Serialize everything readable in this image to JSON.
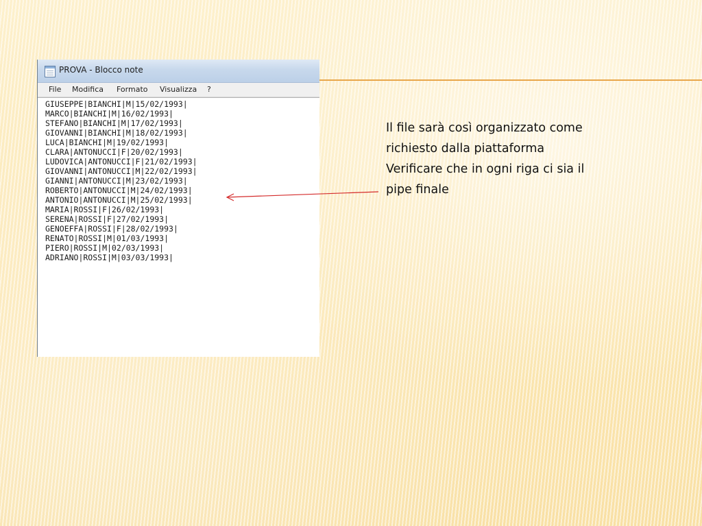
{
  "window": {
    "title": "PROVA - Blocco note",
    "icon": "notepad-icon"
  },
  "menu": [
    "File",
    "Modifica",
    "Formato",
    "Visualizza",
    "?"
  ],
  "editor_lines": [
    "GIUSEPPE|BIANCHI|M|15/02/1993|",
    "MARCO|BIANCHI|M|16/02/1993|",
    "STEFANO|BIANCHI|M|17/02/1993|",
    "GIOVANNI|BIANCHI|M|18/02/1993|",
    "LUCA|BIANCHI|M|19/02/1993|",
    "CLARA|ANTONUCCI|F|20/02/1993|",
    "LUDOVICA|ANTONUCCI|F|21/02/1993|",
    "GIOVANNI|ANTONUCCI|M|22/02/1993|",
    "GIANNI|ANTONUCCI|M|23/02/1993|",
    "ROBERTO|ANTONUCCI|M|24/02/1993|",
    "ANTONIO|ANTONUCCI|M|25/02/1993|",
    "MARIA|ROSSI|F|26/02/1993|",
    "SERENA|ROSSI|F|27/02/1993|",
    "GENOEFFA|ROSSI|F|28/02/1993|",
    "RENATO|ROSSI|M|01/03/1993|",
    "PIERO|ROSSI|M|02/03/1993|",
    "ADRIANO|ROSSI|M|03/03/1993|"
  ],
  "annotation": {
    "lines": [
      "Il file sarà così organizzato come",
      "richiesto dalla piattaforma",
      "Verificare che in ogni riga ci sia il",
      "pipe finale"
    ],
    "arrow_color": "#d42a2a"
  },
  "colors": {
    "accent_line": "#e8a64a",
    "background": "#fbe9b7"
  }
}
